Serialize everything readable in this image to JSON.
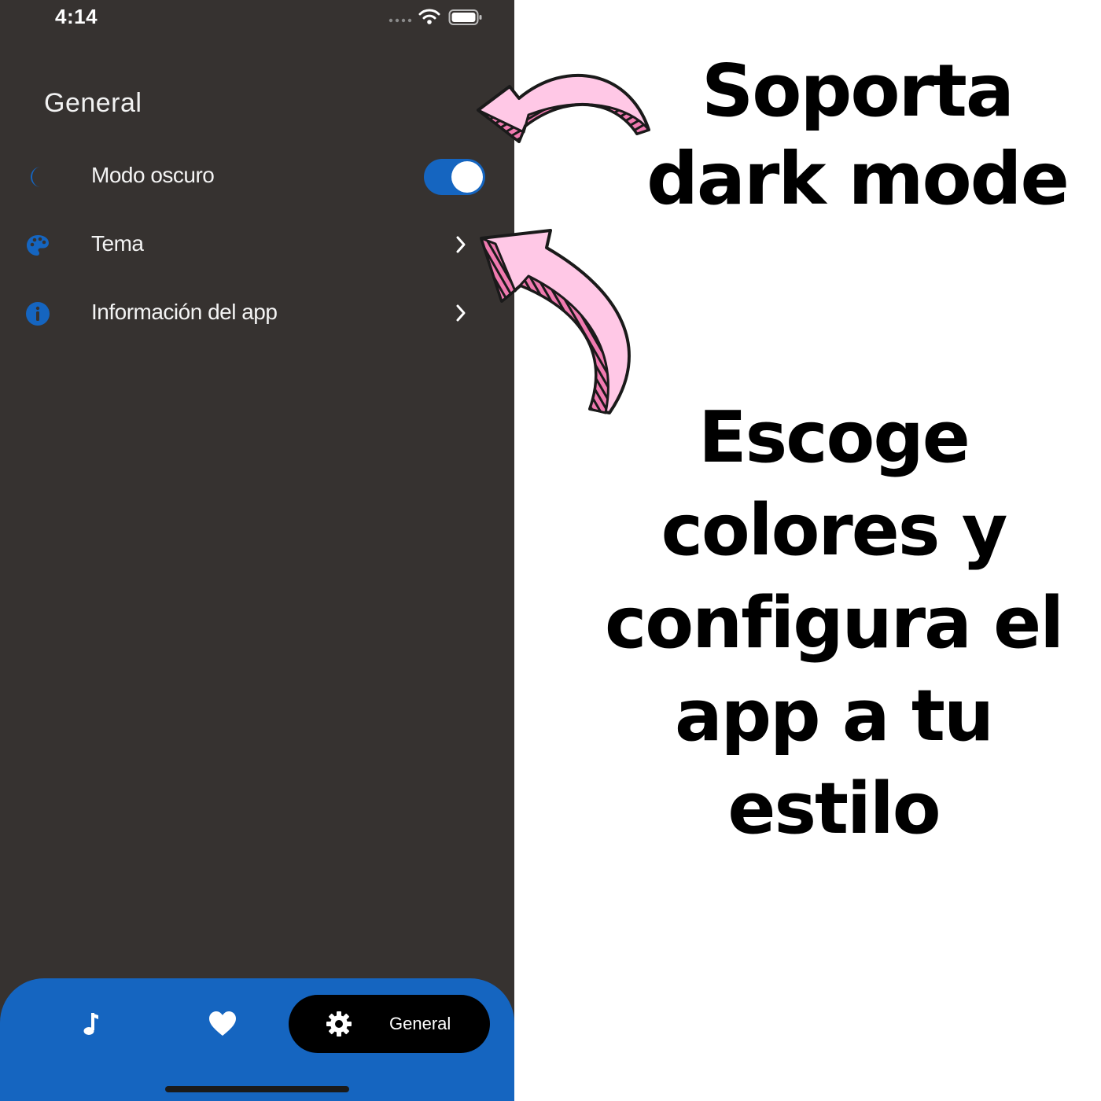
{
  "status_bar": {
    "time": "4:14",
    "icons": [
      "signal-dots-icon",
      "wifi-icon",
      "battery-icon"
    ]
  },
  "settings": {
    "section_title": "General",
    "items": [
      {
        "icon": "moon-icon",
        "label": "Modo oscuro",
        "control": "toggle",
        "toggle_on": true
      },
      {
        "icon": "palette-icon",
        "label": "Tema",
        "control": "chevron"
      },
      {
        "icon": "info-icon",
        "label": "Información del app",
        "control": "chevron"
      }
    ]
  },
  "bottom_nav": {
    "items": [
      {
        "icon": "music-note-icon",
        "active": false
      },
      {
        "icon": "heart-icon",
        "active": false
      },
      {
        "icon": "gear-icon",
        "label": "General",
        "active": true
      }
    ]
  },
  "annotations": {
    "dark_mode": "Soporta dark mode",
    "theme": "Escoge colores y configura el app a tu estilo"
  },
  "colors": {
    "background_dark": "#363230",
    "accent_blue": "#1565c0",
    "arrow_pink": "#ffc8e6",
    "arrow_stripe": "#f07ab0"
  }
}
